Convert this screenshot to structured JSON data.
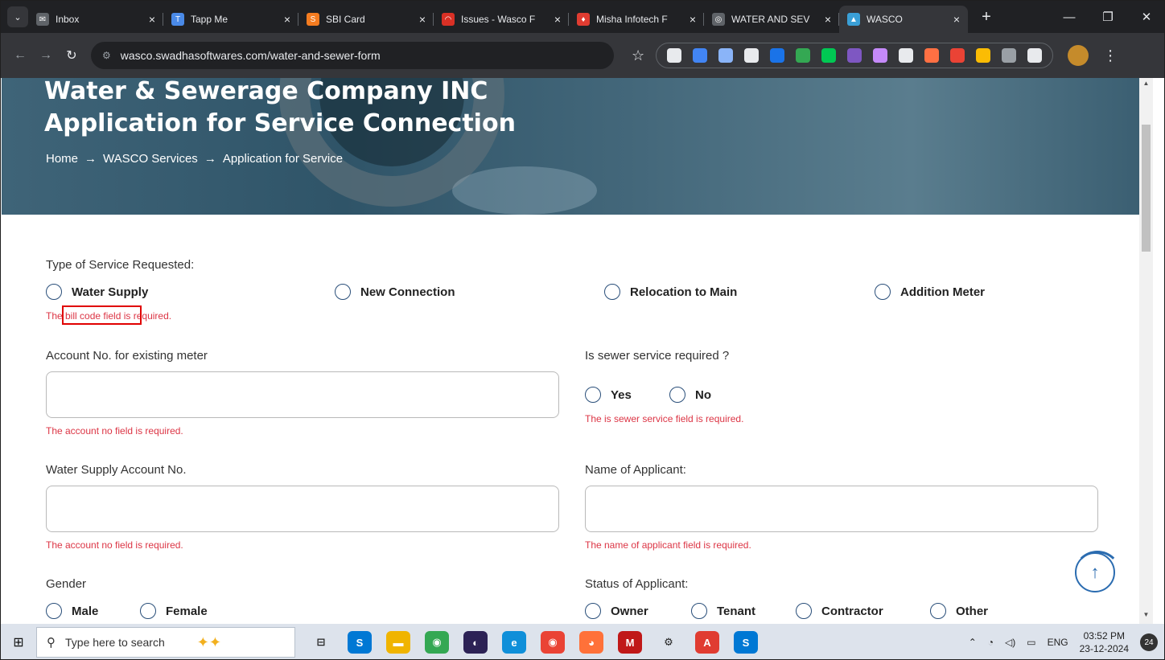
{
  "browser": {
    "tabs": [
      {
        "title": "Inbox",
        "color": "#5f6368",
        "glyph": "✉"
      },
      {
        "title": "Tapp Me",
        "color": "#4a8ae8",
        "glyph": "T"
      },
      {
        "title": "SBI Card",
        "color": "#f47c20",
        "glyph": "S"
      },
      {
        "title": "Issues - Wasco F",
        "color": "#d93025",
        "glyph": "◠"
      },
      {
        "title": "Misha Infotech F",
        "color": "#e03c31",
        "glyph": "♦"
      },
      {
        "title": "WATER AND SEV",
        "color": "#5f6368",
        "glyph": "◎"
      },
      {
        "title": "WASCO",
        "color": "#3a9fd6",
        "glyph": "▲"
      }
    ],
    "url": "wasco.swadhasoftwares.com/water-and-sewer-form",
    "extension_colors": [
      "#e8eaed",
      "#4285f4",
      "#8ab4f8",
      "#e8eaed",
      "#1a73e8",
      "#34a853",
      "#00c853",
      "#7e57c2",
      "#c58af9",
      "#e8eaed",
      "#ff7043",
      "#ea4335",
      "#fbbc04",
      "#9aa0a6",
      "#e8eaed"
    ]
  },
  "hero": {
    "title_line1": "Water & Sewerage Company INC",
    "title_line2": "Application for Service Connection",
    "breadcrumb": [
      "Home",
      "WASCO Services",
      "Application for Service"
    ],
    "breadcrumb_sep": "→"
  },
  "form": {
    "service_type": {
      "label": "Type of Service Requested:",
      "options": [
        "Water Supply",
        "New Connection",
        "Relocation to Main",
        "Addition Meter"
      ],
      "error": "The bill code field is required."
    },
    "account_existing": {
      "label": "Account No. for existing meter",
      "value": "",
      "error": "The account no field is required."
    },
    "sewer": {
      "label": "Is sewer service required ?",
      "options": [
        "Yes",
        "No"
      ],
      "error": "The is sewer service field is required."
    },
    "water_account": {
      "label": "Water Supply Account No.",
      "value": "",
      "error": "The account no field is required."
    },
    "applicant_name": {
      "label": "Name of Applicant:",
      "value": "",
      "error": "The name of applicant field is required."
    },
    "gender": {
      "label": "Gender",
      "options": [
        "Male",
        "Female"
      ]
    },
    "status": {
      "label": "Status of Applicant:",
      "options": [
        "Owner",
        "Tenant",
        "Contractor",
        "Other"
      ]
    }
  },
  "taskbar": {
    "search_placeholder": "Type here to search",
    "apps": [
      {
        "name": "task-view",
        "color": "#dde3ec",
        "glyph": "⊟"
      },
      {
        "name": "skype",
        "color": "#0078d4",
        "glyph": "S"
      },
      {
        "name": "file-explorer",
        "color": "#f0b400",
        "glyph": "▬"
      },
      {
        "name": "chrome",
        "color": "#34a853",
        "glyph": "◉"
      },
      {
        "name": "eclipse",
        "color": "#2c2255",
        "glyph": "◐"
      },
      {
        "name": "edge",
        "color": "#0f8fd9",
        "glyph": "e"
      },
      {
        "name": "chrome-profile",
        "color": "#ea4335",
        "glyph": "◉"
      },
      {
        "name": "firefox",
        "color": "#ff7139",
        "glyph": "◕"
      },
      {
        "name": "mcafee",
        "color": "#c01818",
        "glyph": "M"
      },
      {
        "name": "settings",
        "color": "#dde3ec",
        "glyph": "⚙"
      },
      {
        "name": "acrobat",
        "color": "#e03c31",
        "glyph": "A"
      },
      {
        "name": "skype-2",
        "color": "#0078d4",
        "glyph": "S"
      }
    ],
    "language": "ENG",
    "time": "03:52 PM",
    "date": "23-12-2024",
    "notifications": "24"
  }
}
